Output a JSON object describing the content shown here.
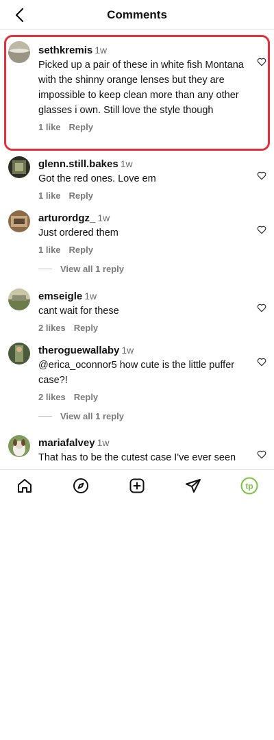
{
  "header": {
    "title": "Comments",
    "back_icon": "chevron-left-icon"
  },
  "comments": [
    {
      "username": "sethkremis",
      "time": "1w",
      "text": "Picked up a pair of these in white fish Montana with the shinny orange lenses but they are impossible to keep clean more than any other glasses i own. Still love the style though",
      "likes": "1 like",
      "reply": "Reply"
    },
    {
      "username": "glenn.still.bakes",
      "time": "1w",
      "text": "Got the red ones. Love em ",
      "likes": "1 like",
      "reply": "Reply"
    },
    {
      "username": "arturordgz_",
      "time": "1w",
      "text": "Just ordered them",
      "likes": "1 like",
      "reply": "Reply",
      "view_replies": "View all 1 reply"
    },
    {
      "username": "emseigle",
      "time": "1w",
      "text": "cant wait for these  ",
      "likes": "2 likes",
      "reply": "Reply"
    },
    {
      "username": "theroguewallaby",
      "time": "1w",
      "text": "@erica_oconnor5 how cute is the little puffer case?!",
      "likes": "2 likes",
      "reply": "Reply",
      "view_replies": "View all 1 reply"
    },
    {
      "username": "mariafalvey",
      "time": "1w",
      "text": "That has to be the cutest case I've ever seen ",
      "likes": "",
      "reply": ""
    }
  ],
  "nav": {
    "items": [
      "home-icon",
      "explore-icon",
      "create-icon",
      "direct-message-icon",
      "profile-icon"
    ],
    "profile_initials": "tp"
  },
  "colors": {
    "highlight": "#e0303c",
    "profile_ring": "#7bc142"
  }
}
